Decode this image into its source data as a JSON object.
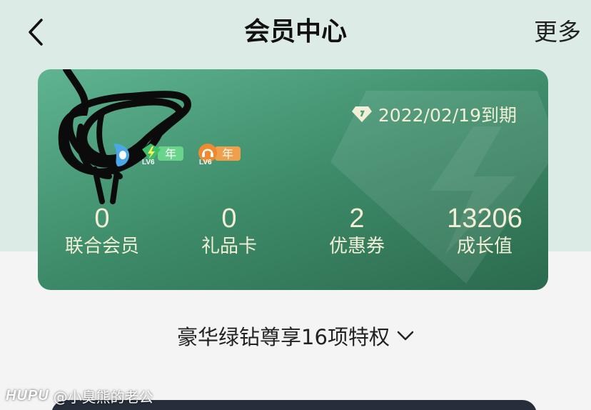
{
  "nav": {
    "title": "会员中心",
    "more_label": "更多",
    "back_icon": "chevron-left-icon"
  },
  "card": {
    "expiry_text": "2022/02/19到期",
    "expiry_icon": "diamond-icon",
    "badges": [
      {
        "icon": "green-diamond-level-icon",
        "level": "LV6",
        "tag": "年",
        "color": "#6ad58a"
      },
      {
        "icon": "orange-music-level-icon",
        "level": "LV6",
        "tag": "年",
        "color": "#f0a04b"
      }
    ],
    "stats": [
      {
        "value": "0",
        "label": "联合会员"
      },
      {
        "value": "0",
        "label": "礼品卡"
      },
      {
        "value": "2",
        "label": "优惠券"
      },
      {
        "value": "13206",
        "label": "成长值"
      }
    ]
  },
  "privileges": {
    "label": "豪华绿钻尊享16项特权"
  },
  "watermark": {
    "brand": "HUPU",
    "handle": "@小臭熊的老公"
  },
  "colors": {
    "page_top": "#dcebe6",
    "card_start": "#5fb491",
    "card_end": "#2b6a4d",
    "card_text": "#f3efd7"
  }
}
